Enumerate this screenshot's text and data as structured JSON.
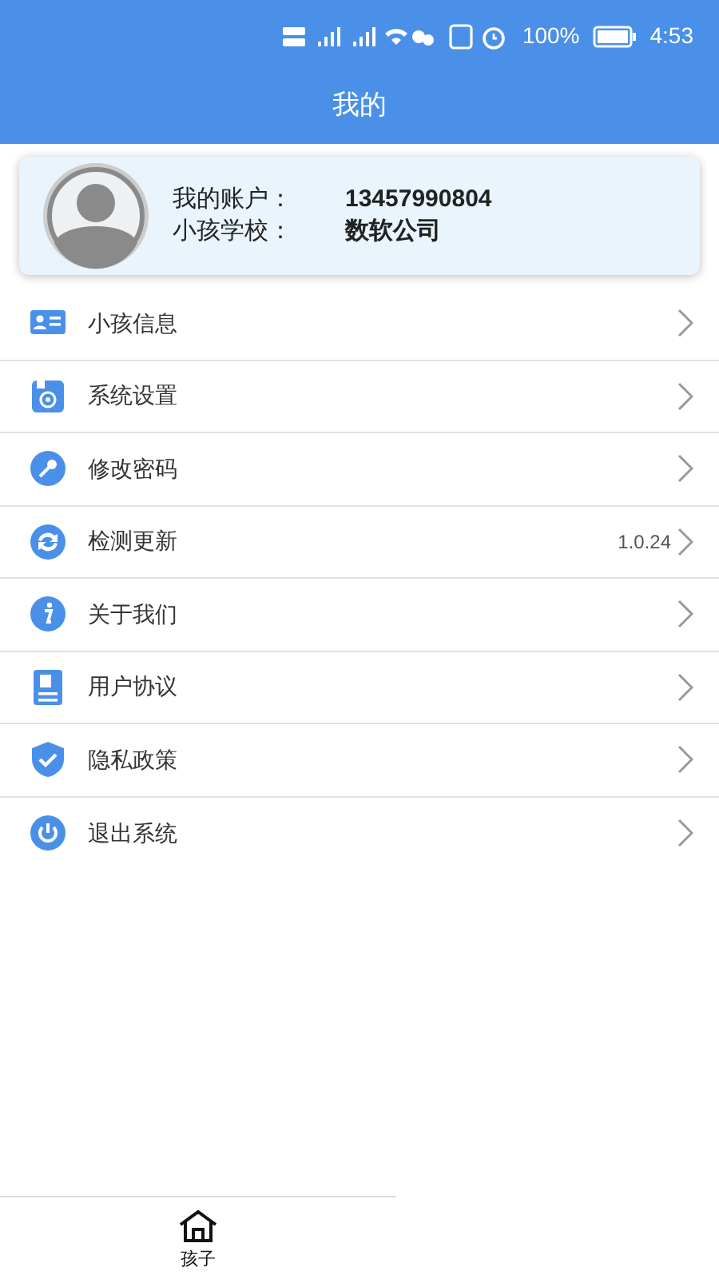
{
  "status_bar": {
    "battery_text": "100%",
    "time": "4:53"
  },
  "header": {
    "title": "我的"
  },
  "profile": {
    "fields": [
      {
        "label": "我的账户：",
        "value": "13457990804"
      },
      {
        "label": "小孩学校：",
        "value": "数软公司"
      }
    ]
  },
  "menu": [
    {
      "kind": "card",
      "label": "小孩信息"
    },
    {
      "kind": "settings",
      "label": "系统设置"
    },
    {
      "kind": "key",
      "label": "修改密码"
    },
    {
      "kind": "update",
      "label": "检测更新",
      "value": "1.0.24"
    },
    {
      "kind": "info",
      "label": "关于我们"
    },
    {
      "kind": "document",
      "label": "用户协议"
    },
    {
      "kind": "shield",
      "label": "隐私政策"
    },
    {
      "kind": "power",
      "label": "退出系统"
    }
  ],
  "tab_bar": [
    {
      "label": "孩子",
      "selected": true
    }
  ]
}
